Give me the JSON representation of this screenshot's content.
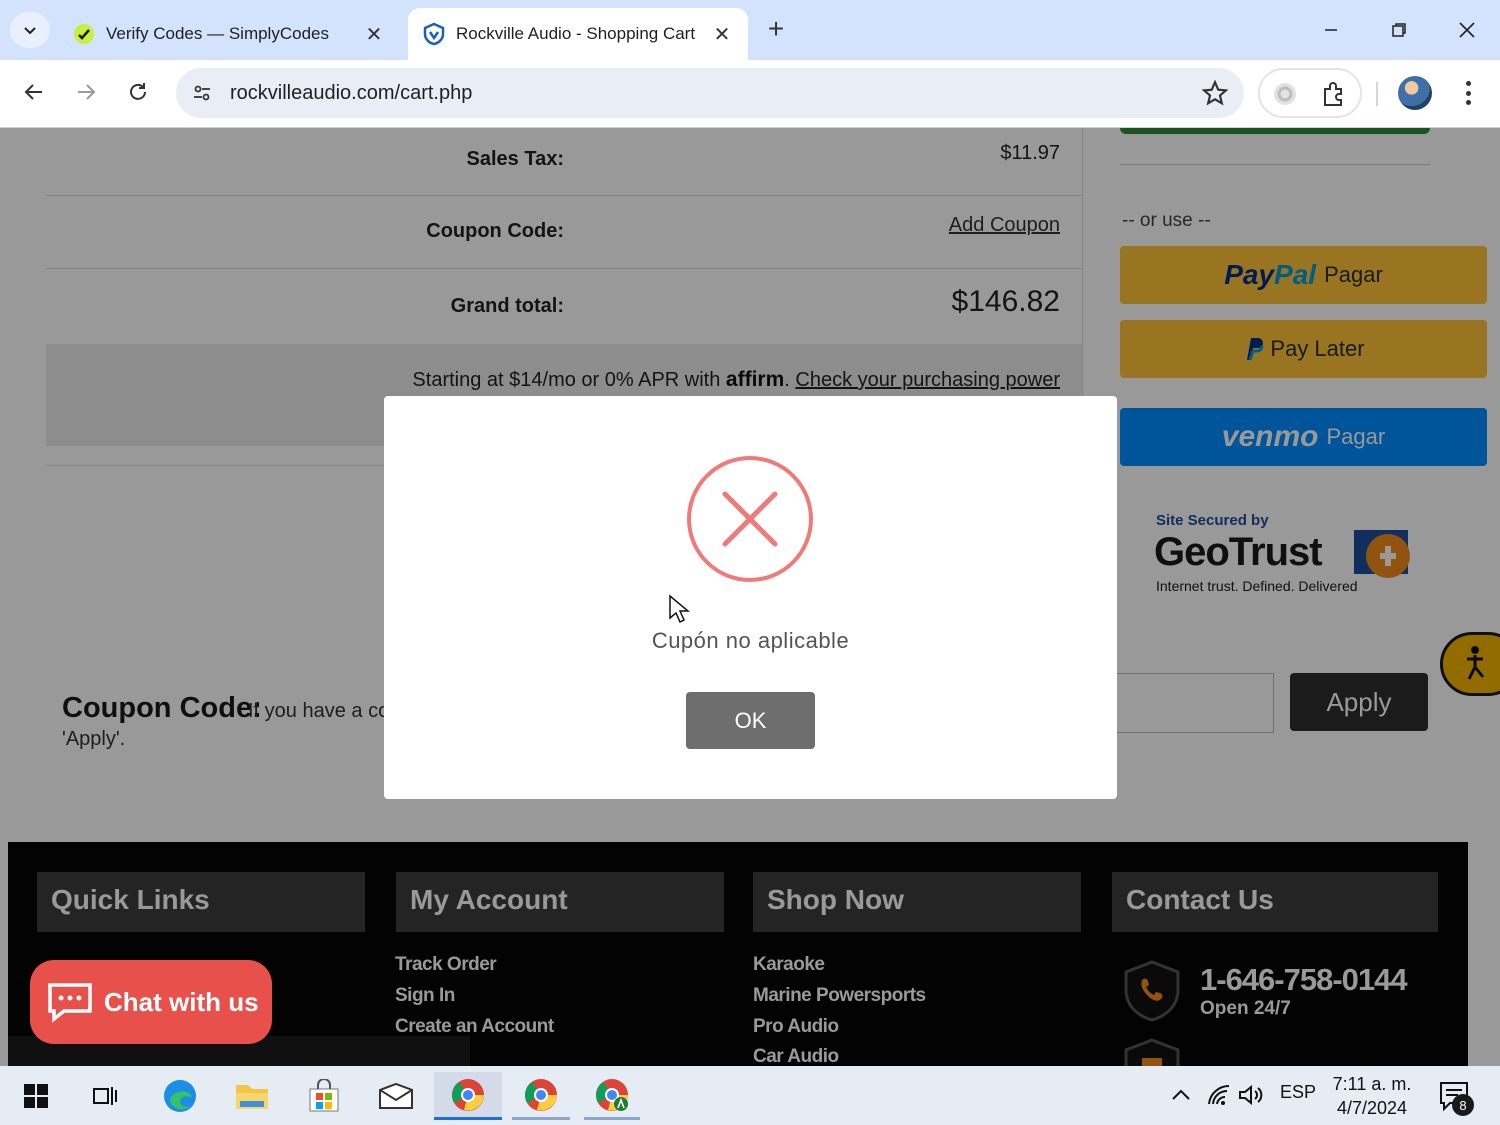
{
  "browser": {
    "tabs": [
      {
        "title": "Verify Codes — SimplyCodes",
        "active": false
      },
      {
        "title": "Rockville Audio - Shopping Cart",
        "active": true
      }
    ],
    "url": "rockvilleaudio.com/cart.php"
  },
  "cart_summary": {
    "sales_tax_label": "Sales Tax:",
    "sales_tax_value": "$11.97",
    "coupon_label": "Coupon Code:",
    "coupon_link": "Add Coupon",
    "grand_total_label": "Grand total:",
    "grand_total_value": "$146.82",
    "affirm_prefix": "Starting at $14/mo or 0% APR with",
    "affirm_brand": "affirm",
    "affirm_link": "Check your purchasing power"
  },
  "checkout_options": {
    "or_use": "-- or use --",
    "paypal_logo_a": "Pay",
    "paypal_logo_b": "Pal",
    "paypal_label": "Pagar",
    "paylater_label": "Pay Later",
    "venmo_logo": "venmo",
    "venmo_label": "Pagar"
  },
  "geotrust": {
    "secured_by": "Site Secured by",
    "brand": "GeoTrust",
    "tagline": "Internet trust. Defined. Delivered"
  },
  "coupon_section": {
    "title": "Coupon Code:",
    "description_visible": "If you have a co",
    "description_line2": "'Apply'.",
    "apply_label": "Apply"
  },
  "modal": {
    "message": "Cupón no aplicable",
    "ok_label": "OK"
  },
  "footer": {
    "quick_links_title": "Quick Links",
    "my_account_title": "My Account",
    "shop_now_title": "Shop Now",
    "contact_title": "Contact Us",
    "my_account_links": [
      "Track Order",
      "Sign In",
      "Create an Account"
    ],
    "shop_now_links": [
      "Karaoke",
      "Marine Powersports",
      "Pro Audio",
      "Car Audio"
    ],
    "phone": "1-646-758-0144",
    "hours": "Open 24/7"
  },
  "chat": {
    "label": "Chat with us"
  },
  "taskbar": {
    "language": "ESP",
    "time": "7:11 a. m.",
    "date": "4/7/2024",
    "notification_count": "8"
  },
  "colors": {
    "tabstrip": "#d3e3fd",
    "paypal_yellow": "#ffc439",
    "venmo_blue": "#008cff",
    "error_red": "#f07a7a",
    "chat_red": "#e8514b",
    "footer_bg": "#050505"
  }
}
